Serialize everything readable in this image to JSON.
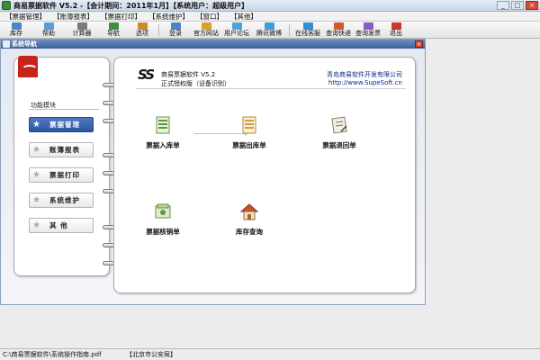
{
  "window": {
    "title": "商易票据软件 V5.2 -【会计期间：2011年1月】【系统用户：超级用户】",
    "min": "_",
    "max": "□",
    "close": "×"
  },
  "menu": [
    "【票据管理】",
    "【账簿报表】",
    "【票据打印】",
    "【系统维护】",
    "【窗口】",
    "【其他】"
  ],
  "toolbar": [
    {
      "label": "库存",
      "icon": "inventory-icon",
      "color": "#4a84c9"
    },
    {
      "label": "帮助",
      "icon": "help-icon",
      "color": "#5a9bd8"
    },
    {
      "label": "计算器",
      "icon": "calculator-icon",
      "color": "#7a7a7a"
    },
    {
      "label": "导航",
      "icon": "navigation-icon",
      "color": "#3d8f3d"
    },
    {
      "label": "选项",
      "icon": "options-icon",
      "color": "#c98a2e"
    },
    {
      "label": "登录",
      "icon": "login-icon",
      "color": "#4a84c9"
    },
    {
      "label": "官方网站",
      "icon": "website-icon",
      "color": "#d7a12c"
    },
    {
      "label": "用户论坛",
      "icon": "forum-icon",
      "color": "#4aa4d8"
    },
    {
      "label": "腾讯微博",
      "icon": "weibo-icon",
      "color": "#3aa0d8"
    },
    {
      "label": "在线客服",
      "icon": "support-icon",
      "color": "#2f8fd0"
    },
    {
      "label": "查询快递",
      "icon": "express-icon",
      "color": "#d05a2a"
    },
    {
      "label": "查询发票",
      "icon": "invoice-search-icon",
      "color": "#8a5ac8"
    },
    {
      "label": "退出",
      "icon": "exit-icon",
      "color": "#c9382a"
    }
  ],
  "child_window": {
    "title": "系统导航",
    "close": "×"
  },
  "left": {
    "title": "功能模块",
    "buttons": [
      "票据管理",
      "账簿报表",
      "票据打印",
      "系统维护",
      "其  他"
    ]
  },
  "header": {
    "logo": "SS",
    "product": "商易票据软件 V5.2",
    "license": "正式授权版（设备识别）",
    "company": "青岛商易软件开发有限公司",
    "website": "http://www.SupeSoft.cn"
  },
  "functions": [
    {
      "label": "票据入库单",
      "icon": "receipt-in-icon"
    },
    {
      "label": "票据出库单",
      "icon": "receipt-out-icon"
    },
    {
      "label": "票据退回单",
      "icon": "receipt-return-icon"
    },
    {
      "label": "票据核销单",
      "icon": "receipt-writeoff-icon"
    },
    {
      "label": "库存查询",
      "icon": "stock-query-icon"
    }
  ],
  "status": {
    "path": "C:\\商易票据软件\\系统操作指南.pdf",
    "org": "【北京市公安局】"
  },
  "colors": {
    "accent": "#2d559e",
    "brand_red": "#c8231b",
    "link": "#0b2c84"
  }
}
